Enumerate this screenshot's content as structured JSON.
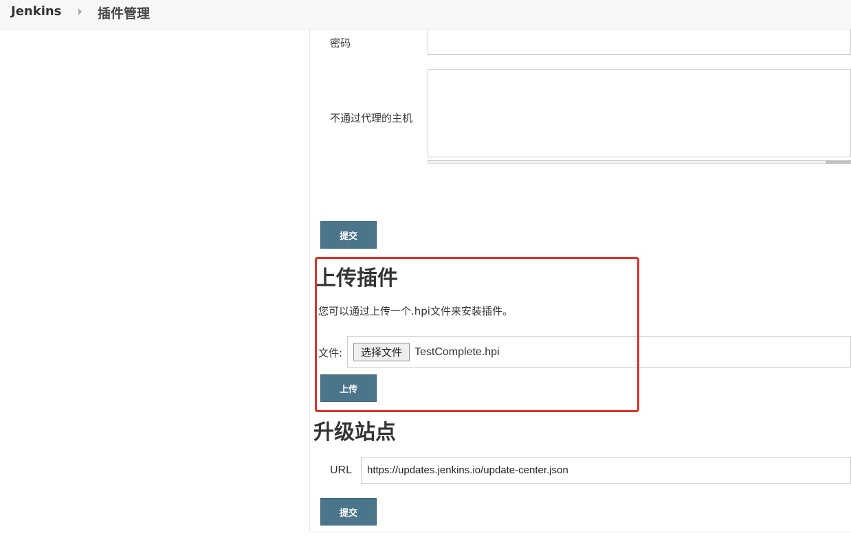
{
  "header": {
    "brand": "Jenkins",
    "breadcrumb_current": "插件管理"
  },
  "proxy": {
    "password_label": "密码",
    "password_value": "",
    "no_proxy_label": "不通过代理的主机",
    "no_proxy_value": "",
    "submit_label": "提交"
  },
  "upload": {
    "title": "上传插件",
    "description": "您可以通过上传一个.hpi文件来安装插件。",
    "file_label": "文件:",
    "choose_button": "选择文件",
    "file_name": "TestComplete.hpi",
    "upload_button": "上传"
  },
  "update_site": {
    "title": "升级站点",
    "url_label": "URL",
    "url_value": "https://updates.jenkins.io/update-center.json",
    "submit_label": "提交"
  },
  "colors": {
    "button_bg": "#4b758b",
    "highlight": "#e1302a"
  }
}
